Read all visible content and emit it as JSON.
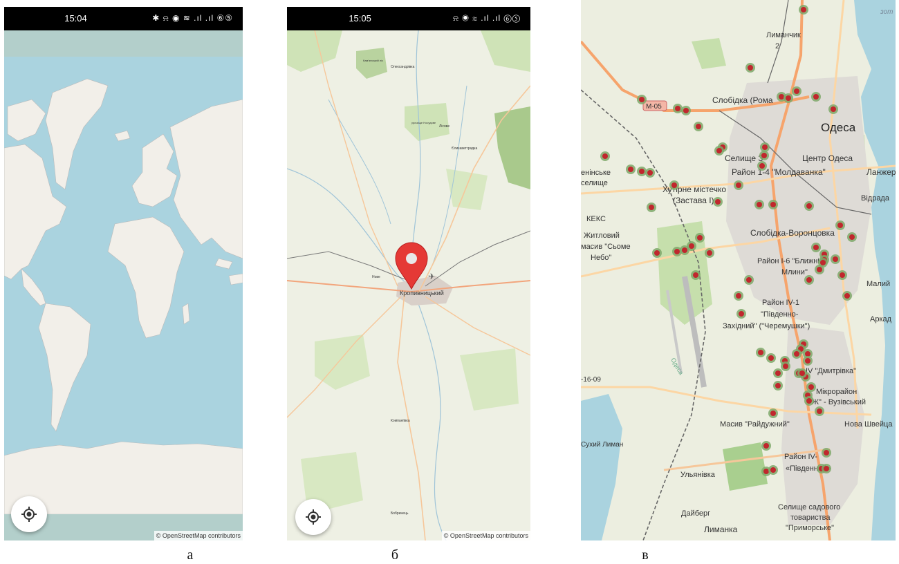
{
  "panel_a": {
    "status_time": "15:04",
    "status_icons": "✱ ⍾ ◉ ≋ .ıl .ıl ⑥⑤",
    "attribution": "© OpenStreetMap contributors",
    "locate_icon": "crosshair-icon",
    "caption": "а"
  },
  "panel_b": {
    "status_time": "15:05",
    "status_icons": "⍾ ◉ ≋ .ıl .ıl ⑥⑤",
    "attribution": "© OpenStreetMap contributors",
    "locate_icon": "crosshair-icon",
    "marker_icon": "map-pin-icon",
    "labels": {
      "city": "Кропивницький",
      "oleksandrivka": "Олександрівка",
      "lisove": "Лісове",
      "yelyzavet": "Єлизаветградка",
      "nove": "Нове",
      "kompaniivka": "Компаніївка",
      "bobrynets": "Бобринець",
      "urochyshche": "урочище Носудове",
      "forest": "Кам'янський ліс"
    },
    "caption": "б"
  },
  "panel_c": {
    "labels": {
      "lymanchyk": "Лиманчик",
      "lymanchyk2": "2",
      "m05": "М-05",
      "slobidka_roma": "Слобідка (Рома",
      "odesa": "Одеса",
      "selyshche": "Селище З",
      "tsentr": "Центр Одеса",
      "rayon14": "Район 1-4 \"Молдаванка\"",
      "lanzhe": "Ланжер",
      "yenins": "енінське",
      "selyshche2": "селище",
      "khutir": "Хутірне містечко",
      "zastava": "(Застава І)",
      "vidrada": "Відрада",
      "keks": "КЕКС",
      "zhytlovyi": "Житловий",
      "masyv": "масив \"Сьоме",
      "nebo": "Небо\"",
      "slobidka_vor": "Слобідка-Воронцовка",
      "rayon16": "Район І-6 \"Ближні",
      "mlyny": "Млини\"",
      "malyi": "Малий",
      "rayon4": "Район IV-1",
      "pivdenno": "\"Південно-",
      "zakhidnyi": "Західний\" (\"Черемушки\")",
      "arkad": "Аркад",
      "m1609": "-16-09",
      "dmytrivka": "IV \"Дмитрівка\"",
      "mikrorayon": "Мікрорайон",
      "zh": "\"Ж\" - Вузівський",
      "masyv_rayd": "Масив \"Райдужний\"",
      "nova_shveits": "Нова Швейца",
      "sukhyi": "Сухий Лиман",
      "rayon_iv": "Район IV-",
      "pivdenny": "«Південний»",
      "ulyanivka": "Ульянівка",
      "dayberg": "Дайберг",
      "lymanka": "Лиманка",
      "selyshche_sad": "Селище садового",
      "tovarystva": "товариства",
      "prymorske": "\"Приморське\"",
      "odesa_road": "Одеса",
      "sea_note": "зот"
    },
    "marker_icon": "stop-marker-icon",
    "caption": "в"
  }
}
